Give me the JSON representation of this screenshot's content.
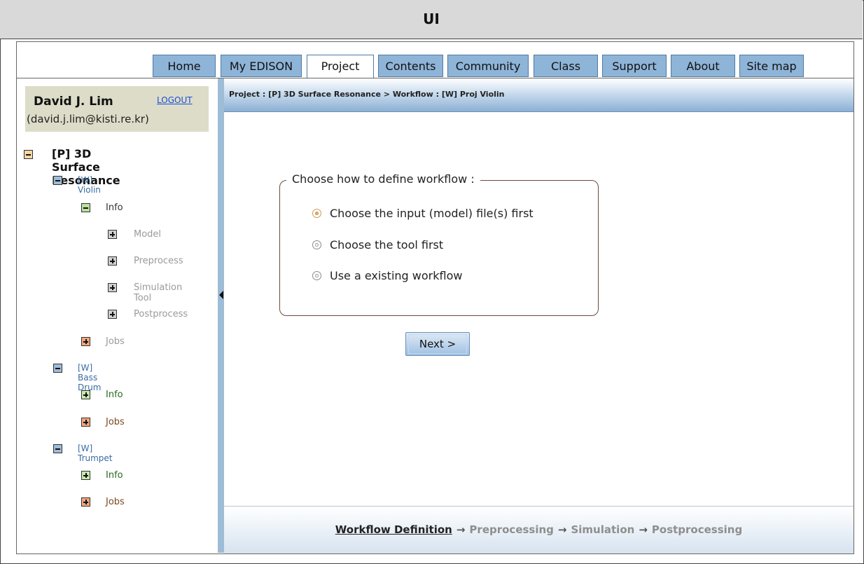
{
  "title": "UI",
  "nav": {
    "tabs": [
      "Home",
      "My EDISON",
      "Project",
      "Contents",
      "Community",
      "Class",
      "Support",
      "About",
      "Site map"
    ],
    "active": "Project"
  },
  "user": {
    "name": "David J. Lim",
    "email": "(david.j.lim@kisti.re.kr)",
    "logout": "LOGOUT"
  },
  "tree": {
    "root": "[P] 3D Surface Resonance",
    "violin": "[W] Violin",
    "violin_info": "Info",
    "model": "Model",
    "preprocess": "Preprocess",
    "simulation_tool": "Simulation Tool",
    "postprocess": "Postprocess",
    "violin_jobs": "Jobs",
    "bass": "[W] Bass Drum",
    "bass_info": "Info",
    "bass_jobs": "Jobs",
    "trumpet": "[W] Trumpet",
    "trumpet_info": "Info",
    "trumpet_jobs": "Jobs"
  },
  "breadcrumb": "Project : [P] 3D Surface Resonance > Workflow : [W] Proj Violin",
  "choice": {
    "legend": "Choose how to define workflow :",
    "options": [
      "Choose the input (model) file(s) first",
      "Choose the tool first",
      "Use a existing workflow"
    ],
    "selected_index": 0
  },
  "next_label": "Next >",
  "steps": {
    "s1": "Workflow Definition",
    "s2": "Preprocessing",
    "s3": "Simulation",
    "s4": "Postprocessing",
    "arrow": "→"
  },
  "colors": {
    "tab_bg": "#8eb4d8",
    "accent": "#9fbcd6",
    "userbox": "#dcdcc8"
  }
}
